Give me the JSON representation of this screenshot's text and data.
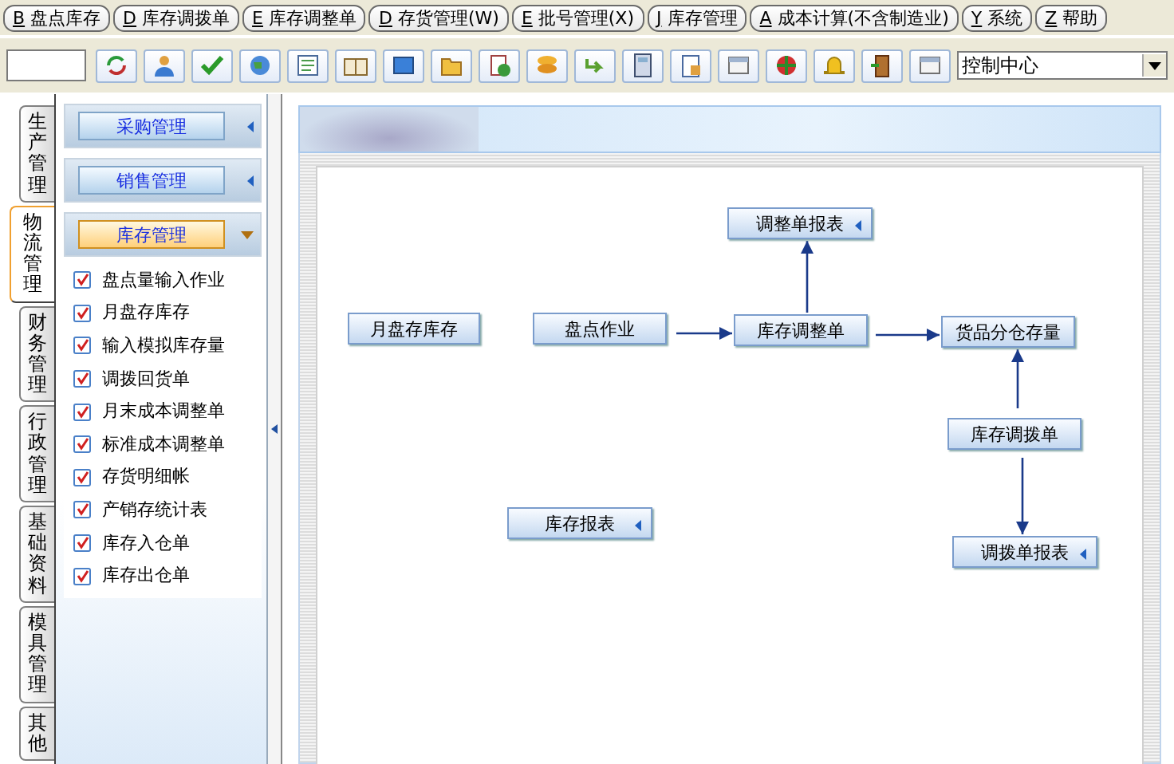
{
  "menu_bar": [
    {
      "key": "B",
      "label": "盘点库存"
    },
    {
      "key": "D",
      "label": "库存调拨单"
    },
    {
      "key": "E",
      "label": "库存调整单"
    },
    {
      "key": "D",
      "label": "存货管理(W)"
    },
    {
      "key": "E",
      "label": "批号管理(X)"
    },
    {
      "key": "J",
      "label": "库存管理"
    },
    {
      "key": "A",
      "label": "成本计算(不含制造业)"
    },
    {
      "key": "Y",
      "label": "系统"
    },
    {
      "key": "Z",
      "label": "帮助"
    }
  ],
  "toolbar": {
    "dropdown": {
      "value": "控制中心"
    }
  },
  "side_tabs": [
    {
      "label": "生产管理",
      "selected": false
    },
    {
      "label": "物流管理",
      "selected": true
    },
    {
      "label": "财务管理",
      "selected": false
    },
    {
      "label": "行政管理",
      "selected": false
    },
    {
      "label": "基础资料",
      "selected": false
    },
    {
      "label": "模具管理",
      "selected": false
    },
    {
      "label": "其他",
      "selected": false
    }
  ],
  "sidebar": {
    "sections": [
      {
        "label": "采购管理",
        "expanded": false
      },
      {
        "label": "销售管理",
        "expanded": false
      },
      {
        "label": "库存管理",
        "expanded": true,
        "items": [
          "盘点量输入作业",
          "月盘存库存",
          "输入模拟库存量",
          "调拨回货单",
          "月末成本调整单",
          "标准成本调整单",
          "存货明细帐",
          "产销存统计表",
          "库存入仓单",
          "库存出仓单"
        ]
      }
    ]
  },
  "flowchart": {
    "nodes": [
      {
        "label": "调整单报表",
        "kind": "report"
      },
      {
        "label": "月盘存库存",
        "kind": "process"
      },
      {
        "label": "盘点作业",
        "kind": "process"
      },
      {
        "label": "库存调整单",
        "kind": "process"
      },
      {
        "label": "货品分仓存量",
        "kind": "process"
      },
      {
        "label": "库存调拨单",
        "kind": "process"
      },
      {
        "label": "库存报表",
        "kind": "report"
      },
      {
        "label": "调拨单报表",
        "kind": "report"
      }
    ]
  }
}
